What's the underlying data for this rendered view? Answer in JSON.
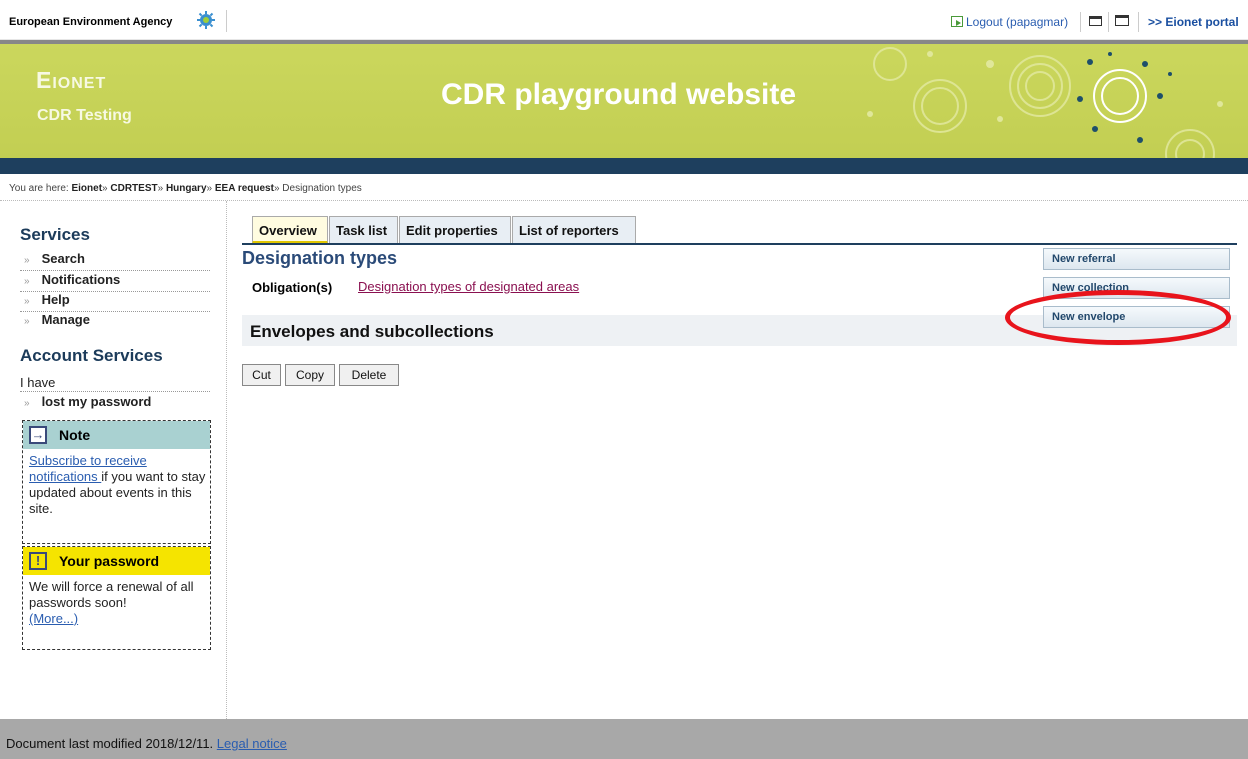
{
  "topbar": {
    "agency": "European Environment Agency",
    "logout": "Logout (papagmar)",
    "portal": ">> Eionet portal"
  },
  "banner": {
    "eionet": "Eionet",
    "subtitle": "CDR Testing",
    "site_title": "CDR playground website"
  },
  "breadcrumb": {
    "prefix": "You are here:",
    "items": [
      "Eionet",
      "CDRTEST",
      "Hungary",
      "EEA request",
      "Designation types"
    ]
  },
  "sidebar": {
    "services_heading": "Services",
    "services": [
      {
        "label": "Search"
      },
      {
        "label": "Notifications"
      },
      {
        "label": "Help"
      },
      {
        "label": "Manage"
      }
    ],
    "account_heading": "Account Services",
    "account_intro": "I have",
    "account_items": [
      {
        "label": "lost my password"
      }
    ],
    "note": {
      "title": "Note",
      "link": "Subscribe to receive notifications ",
      "text": "if you want to stay updated about events in this site."
    },
    "password": {
      "title": "Your password",
      "text": "We will force a renewal of all passwords soon!",
      "link": "(More...)"
    }
  },
  "tabs": [
    {
      "label": "Overview",
      "active": true
    },
    {
      "label": "Task list"
    },
    {
      "label": "Edit properties"
    },
    {
      "label": "List of reporters"
    }
  ],
  "main": {
    "title": "Designation types",
    "obligation_label": "Obligation(s)",
    "obligation_link": "Designation types of designated areas",
    "envelopes_heading": "Envelopes and subcollections",
    "actions": [
      "New referral",
      "New collection",
      "New envelope"
    ],
    "buttons": [
      "Cut",
      "Copy",
      "Delete"
    ]
  },
  "footer": {
    "text": "Document last modified 2018/12/11.",
    "link": "Legal notice"
  },
  "colors": {
    "banner": "#c8d45a",
    "darkbar": "#1e3f5e",
    "annotation": "#e8141c"
  }
}
